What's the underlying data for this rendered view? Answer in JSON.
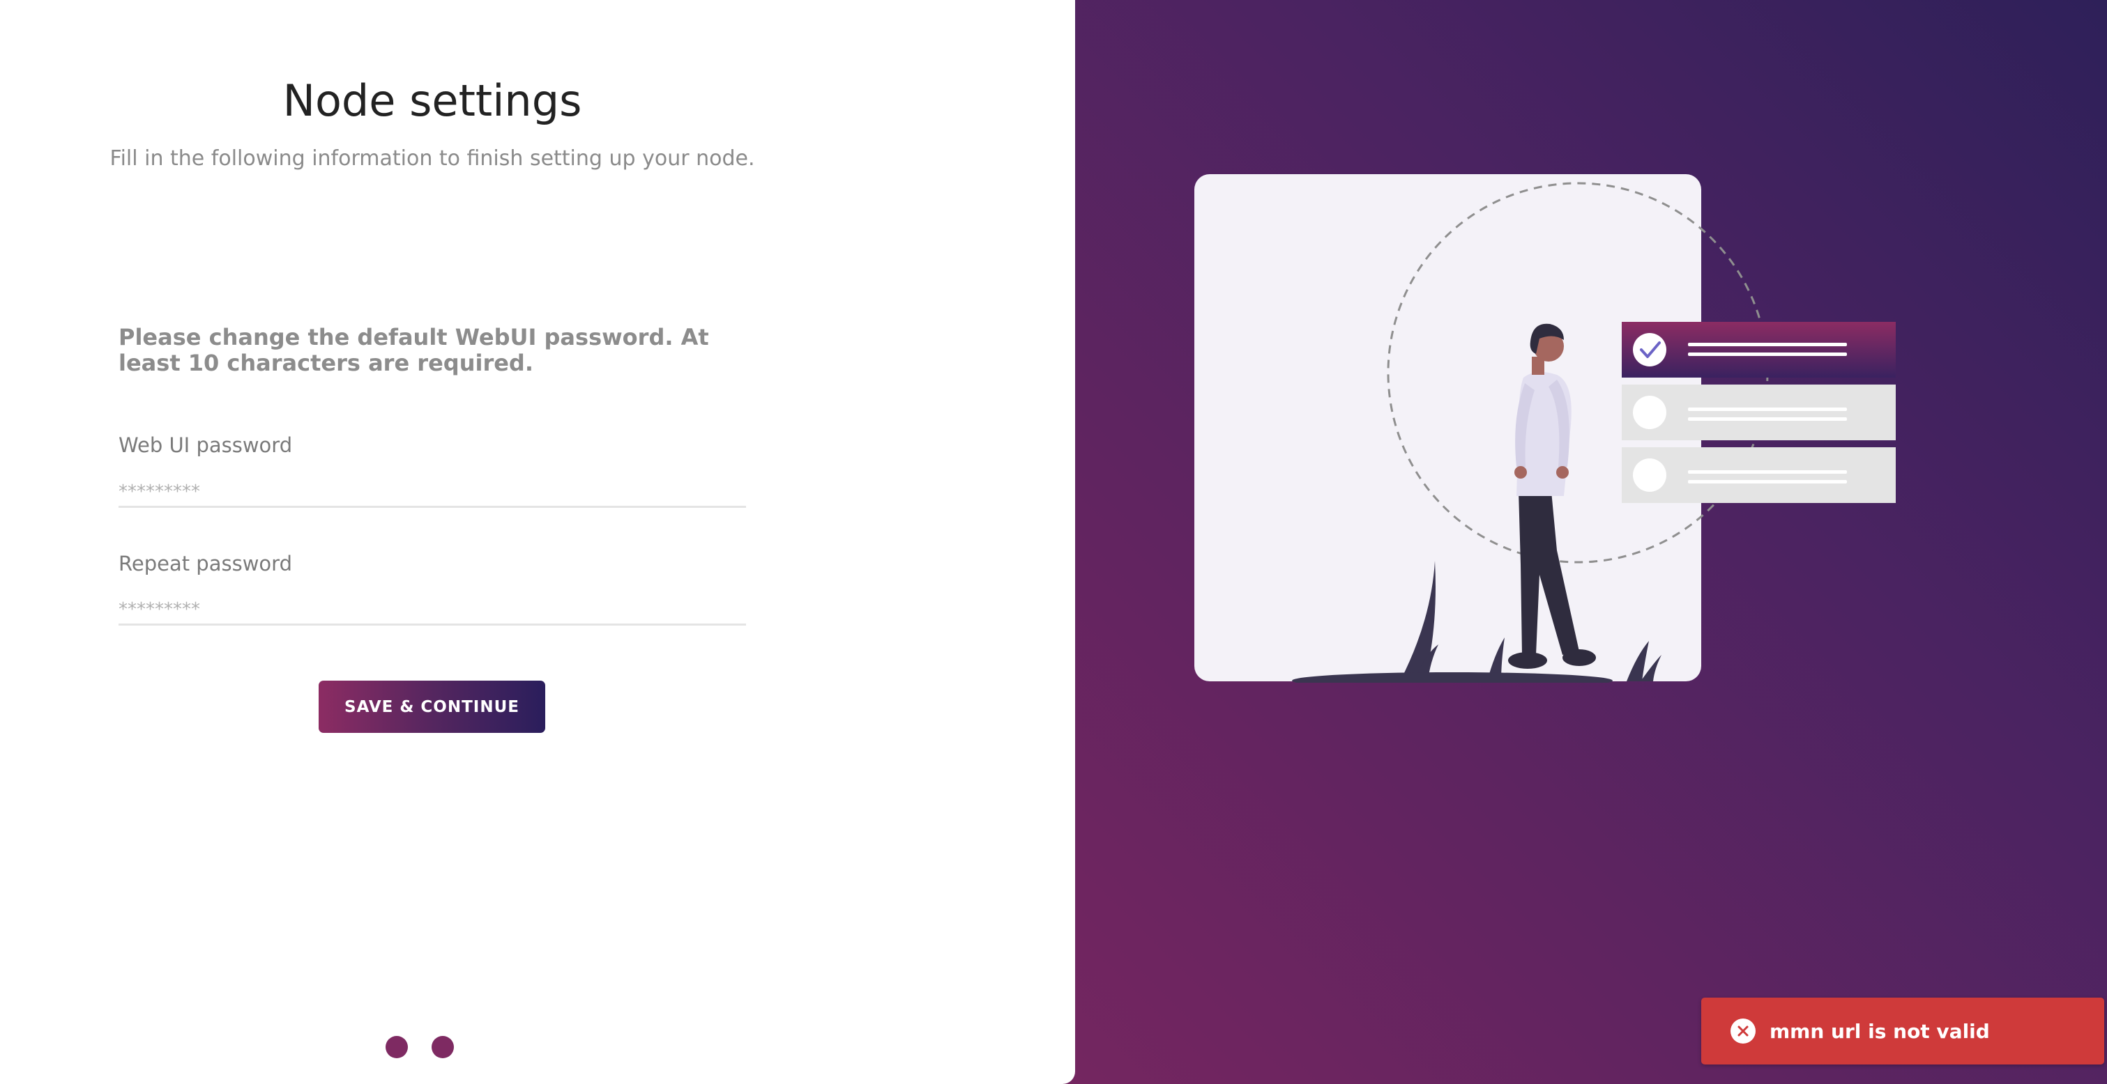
{
  "header": {
    "title": "Node settings",
    "subtitle": "Fill in the following information to finish setting up your node."
  },
  "form": {
    "notice": "Please change the default WebUI password. At least 10 characters are required.",
    "password_label": "Web UI password",
    "password_placeholder": "*********",
    "repeat_label": "Repeat password",
    "repeat_placeholder": "*********",
    "submit_label": "SAVE & CONTINUE"
  },
  "pagination": {
    "total": 2
  },
  "illustration": {
    "icon": "person-checklist-illustration",
    "checklist_items": 3,
    "checked_items": 1
  },
  "toast": {
    "type": "error",
    "message": "mmn url is not valid",
    "color": "#cf3a3a"
  },
  "theme": {
    "accent": "#8c2c63",
    "accent_dark": "#2a1e5c"
  }
}
